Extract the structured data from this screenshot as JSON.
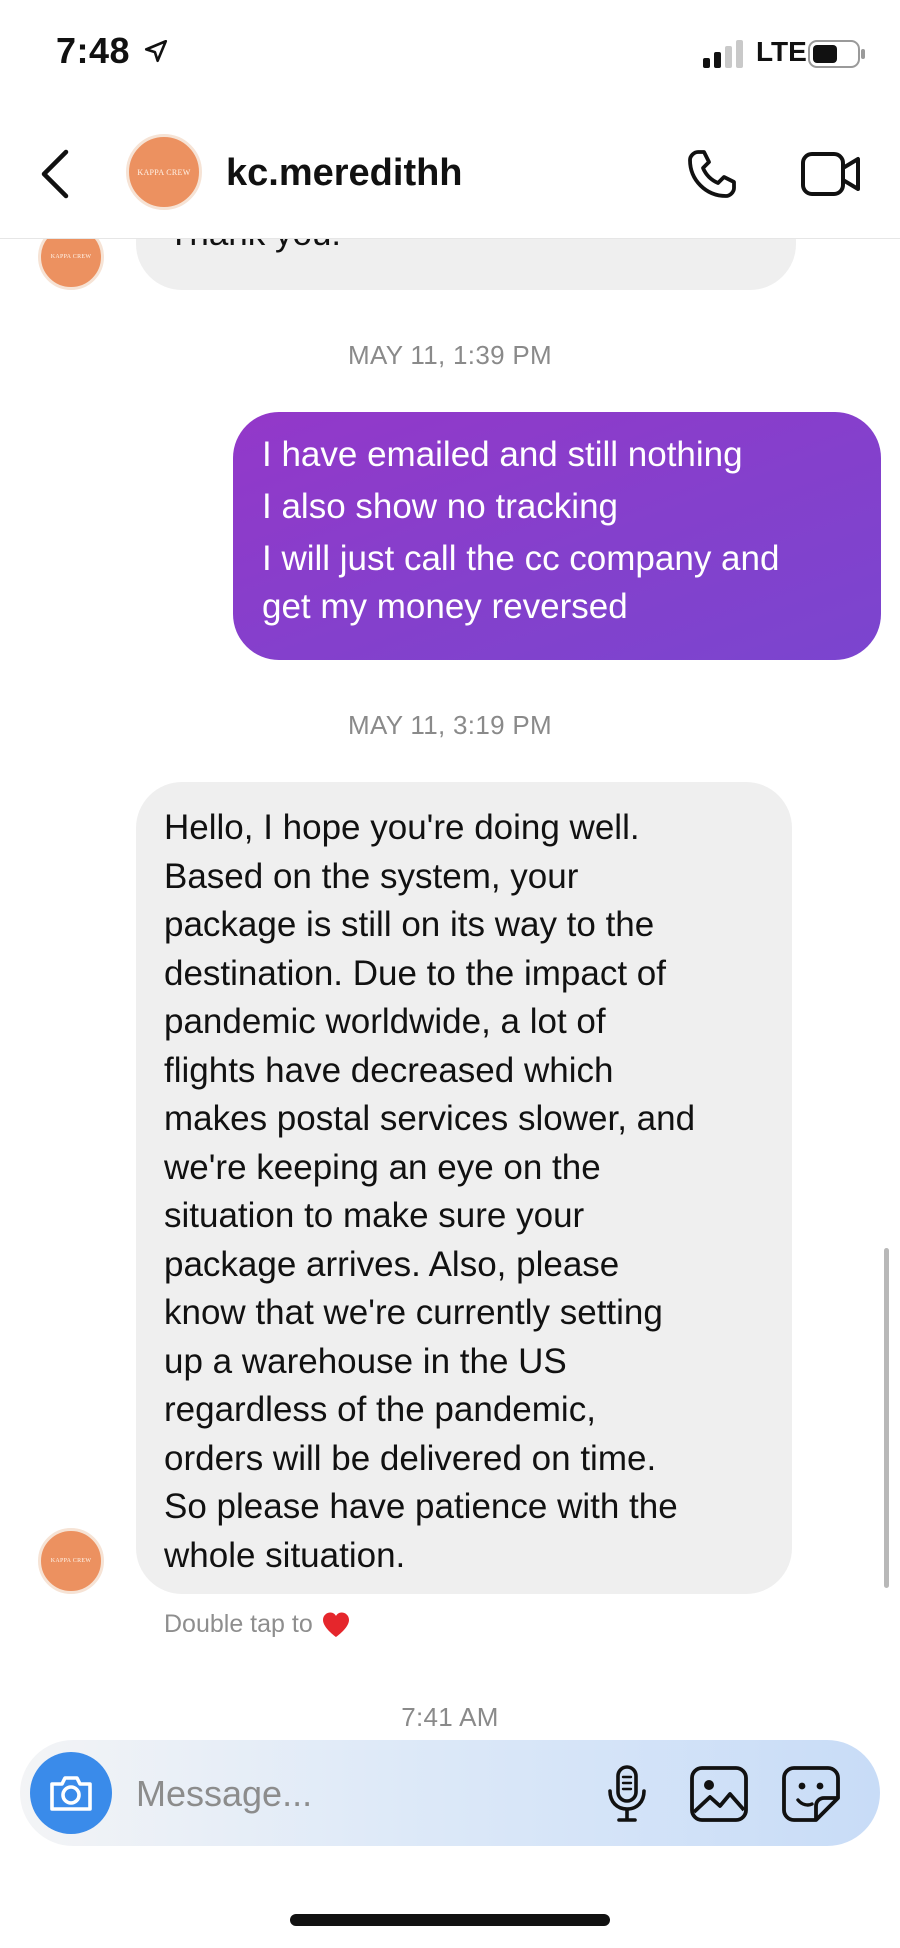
{
  "status_bar": {
    "time": "7:48",
    "network": "LTE"
  },
  "header": {
    "username": "kc.meredithh",
    "avatar_text": "KAPPA CREW"
  },
  "messages": {
    "partial_incoming": "Thank you!",
    "timestamp_1": "MAY 11, 1:39 PM",
    "outgoing_lines": [
      "I have emailed and still nothing",
      "I also show no tracking",
      "I will just call the cc company and",
      "get my money reversed"
    ],
    "timestamp_2": "MAY 11, 3:19 PM",
    "incoming_lines": [
      "Hello, I hope you're doing well.",
      "Based on the system, your",
      "package is still on its way to the",
      "destination. Due to the impact of",
      "pandemic worldwide, a lot of",
      "flights have decreased which",
      "makes postal services slower, and",
      "we're keeping an eye on the",
      "situation to make sure your",
      "package arrives. Also, please",
      "know that we're currently setting",
      "up a warehouse in the US",
      "regardless of the pandemic,",
      "orders will be delivered on time.",
      "So please have patience with the",
      "whole situation."
    ],
    "double_tap_hint": "Double tap to",
    "timestamp_3": "7:41 AM"
  },
  "composer": {
    "placeholder": "Message..."
  },
  "colors": {
    "outgoing_bubble": "#8a3ecb",
    "incoming_bubble": "#efefef",
    "camera_button": "#3a8bea",
    "avatar": "#ec9160",
    "heart": "#e5262c"
  },
  "icons": {
    "status": [
      "location-arrow-icon",
      "signal-icon",
      "battery-icon"
    ],
    "header": [
      "back-chevron-icon",
      "phone-icon",
      "video-camera-icon"
    ],
    "composer": [
      "camera-icon",
      "microphone-icon",
      "gallery-icon",
      "sticker-icon"
    ],
    "hint": "heart-icon"
  }
}
